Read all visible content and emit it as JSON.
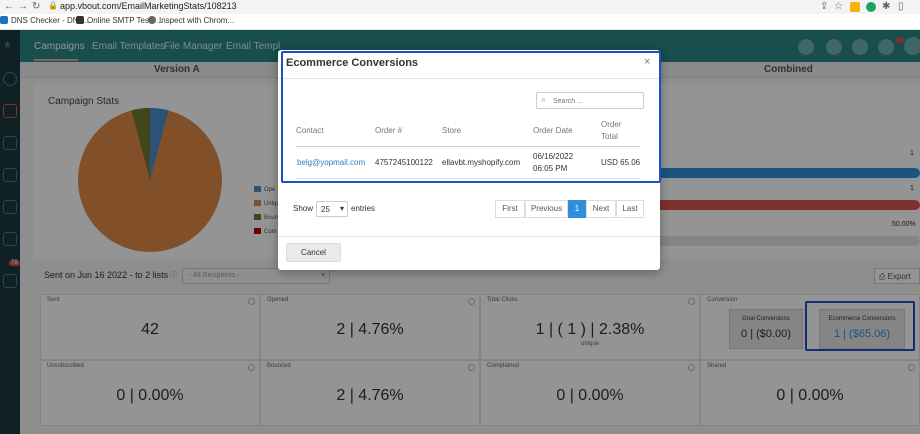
{
  "browser": {
    "url": "app.vbout.com/EmailMarketingStats/108213",
    "bookmarks": [
      "DNS Checker - DNS...",
      "Online SMTP Test -...",
      "Inspect with Chrom..."
    ]
  },
  "nav": {
    "tabs": [
      "Campaigns",
      "Email Templates",
      "File Manager",
      "Email Templ"
    ],
    "badge": "79"
  },
  "versions": {
    "a": "Version A",
    "combined": "Combined"
  },
  "stats": {
    "title": "Campaign Stats",
    "legend": [
      "Ope",
      "Unique",
      "Boun",
      "Com"
    ],
    "bars": [
      {
        "value": "1"
      },
      {
        "value": "1"
      },
      {
        "value": "50.00%"
      }
    ]
  },
  "sent": {
    "text": "Sent on Jun 16 2022 - to 2 lists",
    "recipients_placeholder": "- All Recipients -",
    "export": "Export"
  },
  "cells": {
    "sent": {
      "title": "Sent",
      "value": "42"
    },
    "opened": {
      "title": "Opened",
      "value": "2 | 4.76%"
    },
    "clicks": {
      "title": "Total Clicks",
      "value": "1 | ( 1 ) | 2.38%",
      "sub": "unique"
    },
    "conversion": {
      "title": "Conversion",
      "goal_title": "Goal Conversions",
      "goal_value": "0 | ($0.00)",
      "ecom_title": "Ecommerce Conversions",
      "ecom_value": "1 | ($65.06)"
    },
    "unsub": {
      "title": "Unsubscribed",
      "value": "0 | 0.00%"
    },
    "bounced": {
      "title": "Bounced",
      "value": "2 | 4.76%"
    },
    "complained": {
      "title": "Complained",
      "value": "0 | 0.00%"
    },
    "shared": {
      "title": "Shared",
      "value": "0 | 0.00%"
    }
  },
  "modal": {
    "title": "Ecommerce Conversions",
    "close": "×",
    "search_placeholder": "Search ...",
    "columns": {
      "contact": "Contact",
      "order": "Order #",
      "store": "Store",
      "date": "Order Date",
      "total1": "Order",
      "total2": "Total"
    },
    "row": {
      "contact": "belg@yopmail.com",
      "order": "4757245100122",
      "store": "ellavbt.myshopify.com",
      "date1": "06/16/2022",
      "date2": "06:05 PM",
      "total": "USD 65.06"
    },
    "show_label": "Show",
    "show_value": "25",
    "entries_label": "entries",
    "pager": {
      "first": "First",
      "previous": "Previous",
      "current": "1",
      "next": "Next",
      "last": "Last"
    },
    "cancel": "Cancel"
  },
  "colors": {
    "teal_nav": "#2a8787",
    "sidebar": "#1c3a40",
    "pie_orange": "#e08a45",
    "pie_blue": "#4a8fc6",
    "pie_olive": "#6f7a31",
    "accent_blue": "#2f8fdc",
    "focus_blue": "#1f4fc7"
  }
}
